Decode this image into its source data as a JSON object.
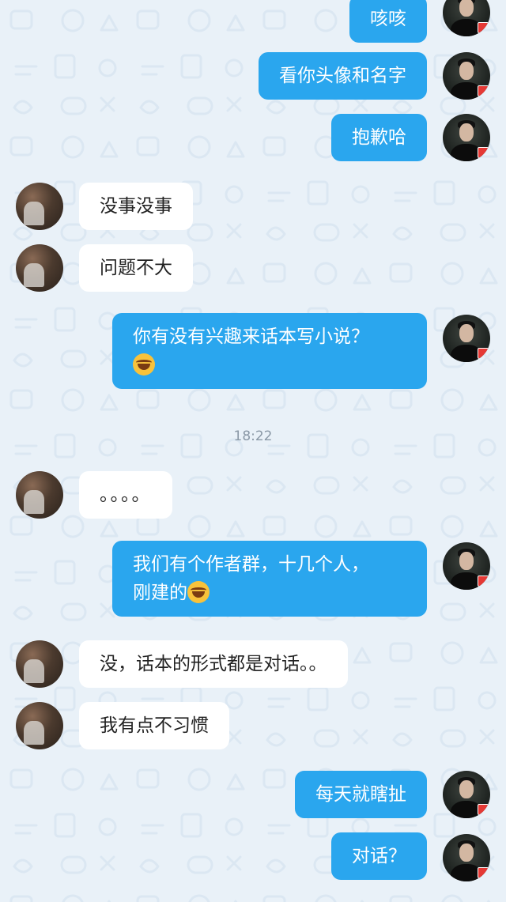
{
  "colors": {
    "background": "#e9f1f8",
    "outgoing_bubble": "#2aa6ee",
    "incoming_bubble": "#ffffff"
  },
  "messages": [
    {
      "side": "right",
      "text": "咳咳"
    },
    {
      "side": "right",
      "text": "看你头像和名字"
    },
    {
      "side": "right",
      "text": "抱歉哈"
    },
    {
      "side": "left",
      "text": "没事没事"
    },
    {
      "side": "left",
      "text": "问题不大"
    },
    {
      "side": "right",
      "text": "你有没有兴趣来话本写小说？",
      "emoji": "laughing-tears-emoji"
    },
    {
      "side": "left",
      "text": "。。。。"
    },
    {
      "side": "right",
      "line1": "我们有个作者群，十几个人，",
      "line2": "刚建的",
      "emoji": "laughing-tears-emoji"
    },
    {
      "side": "left",
      "text": "没，话本的形式都是对话。。"
    },
    {
      "side": "left",
      "text": "我有点不习惯"
    },
    {
      "side": "right",
      "text": "每天就瞎扯"
    },
    {
      "side": "right",
      "text": "对话？"
    }
  ],
  "timestamp": "18:22"
}
